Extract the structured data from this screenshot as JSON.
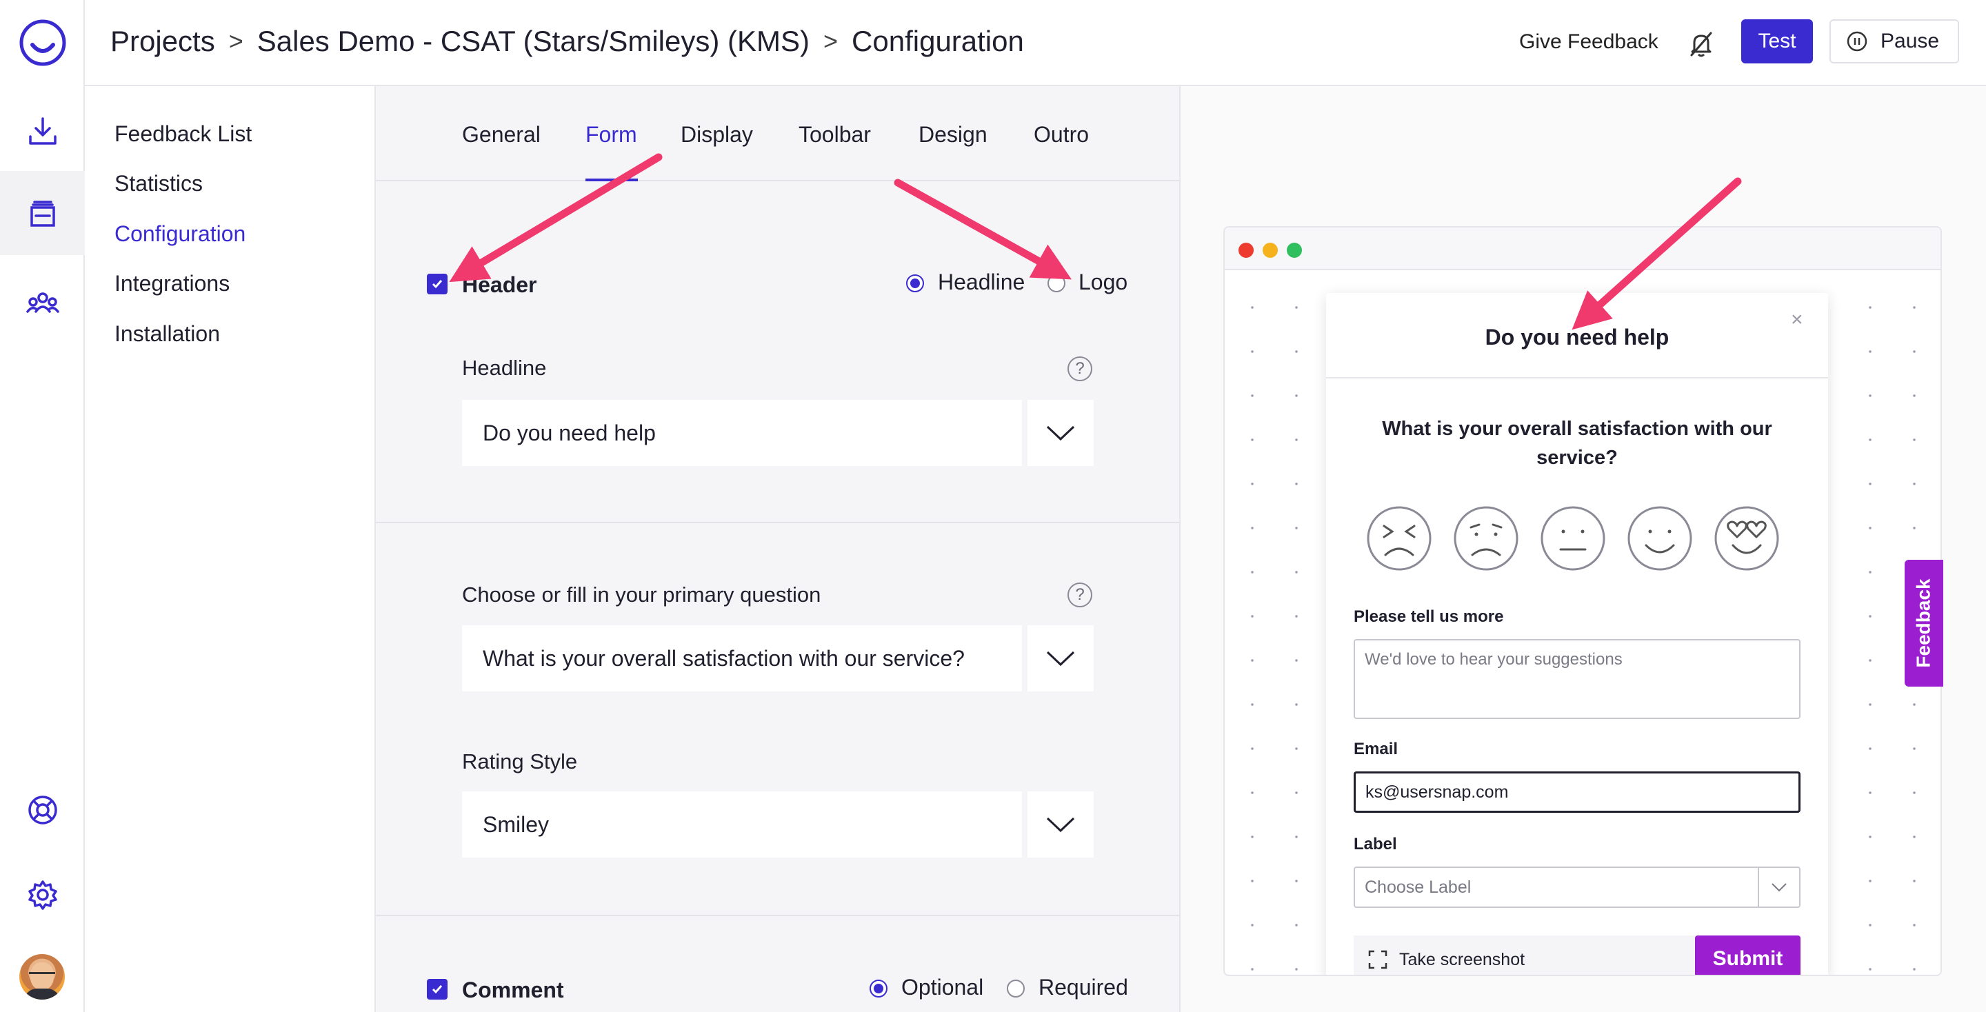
{
  "topbar": {
    "breadcrumb": [
      "Projects",
      "Sales Demo - CSAT (Stars/Smileys) (KMS)",
      "Configuration"
    ],
    "separator": ">",
    "give_feedback": "Give Feedback",
    "test_label": "Test",
    "pause_label": "Pause"
  },
  "rail": {
    "icons": [
      "logo-icon",
      "download-icon",
      "inbox-icon",
      "team-icon",
      "help-lifebuoy-icon",
      "settings-icon",
      "user-avatar"
    ]
  },
  "subnav": {
    "items": [
      {
        "label": "Feedback List",
        "active": false
      },
      {
        "label": "Statistics",
        "active": false
      },
      {
        "label": "Configuration",
        "active": true
      },
      {
        "label": "Integrations",
        "active": false
      },
      {
        "label": "Installation",
        "active": false
      }
    ]
  },
  "tabs": [
    {
      "label": "General",
      "active": false
    },
    {
      "label": "Form",
      "active": true
    },
    {
      "label": "Display",
      "active": false
    },
    {
      "label": "Toolbar",
      "active": false
    },
    {
      "label": "Design",
      "active": false
    },
    {
      "label": "Outro",
      "active": false
    }
  ],
  "header_section": {
    "title": "Header",
    "checked": true,
    "option_headline": "Headline",
    "option_logo": "Logo",
    "selected": "Headline",
    "headline_label": "Headline",
    "headline_value": "Do you need help",
    "help": "?"
  },
  "question_section": {
    "label": "Choose or fill in your primary question",
    "value": "What is your overall satisfaction with our service?",
    "help": "?",
    "rating_label": "Rating Style",
    "rating_value": "Smiley"
  },
  "comment_section": {
    "title": "Comment",
    "checked": true,
    "option_optional": "Optional",
    "option_required": "Required",
    "selected": "Optional"
  },
  "preview": {
    "title": "Do you need help",
    "close": "×",
    "question": "What is your overall satisfaction with our service?",
    "smileys": [
      "very-unhappy-face-icon",
      "unhappy-face-icon",
      "neutral-face-icon",
      "happy-face-icon",
      "heart-eyes-face-icon"
    ],
    "tell_more_label": "Please tell us more",
    "tell_more_placeholder": "We'd love to hear your suggestions",
    "email_label": "Email",
    "email_value": "ks@usersnap.com",
    "label_label": "Label",
    "label_placeholder": "Choose Label",
    "screenshot_label": "Take screenshot",
    "submit_label": "Submit",
    "feedback_tab": "Feedback"
  },
  "colors": {
    "accent": "#3a2bd1",
    "widget_accent": "#9b1fd0",
    "arrow": "#f03a6e"
  }
}
